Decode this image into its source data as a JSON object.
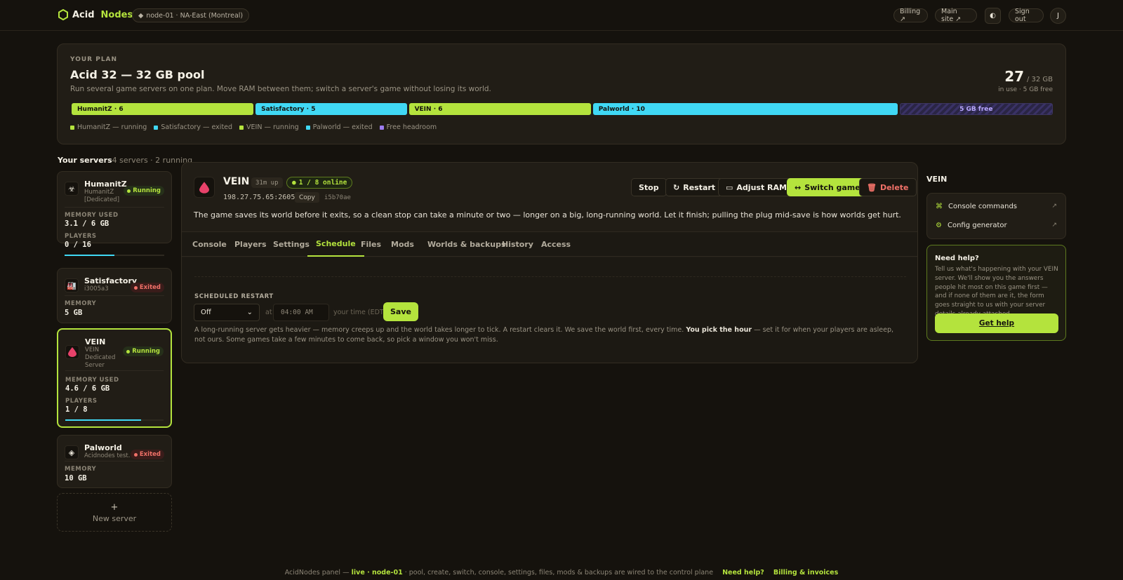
{
  "header": {
    "brand_a": "Acid",
    "brand_b": "Nodes",
    "node": "node-01 · NA-East (Montreal)",
    "billing": "Billing ↗",
    "main_site": "Main site ↗",
    "theme_icon": "◐",
    "sign_out": "Sign out",
    "avatar": "J"
  },
  "plan": {
    "eyebrow": "YOUR PLAN",
    "title": "Acid 32 — 32 GB pool",
    "subtitle": "Run several game servers on one plan. Move RAM between them; switch a server's game without losing its world.",
    "used": "27",
    "total": "/ 32 GB",
    "note": "in use · 5 GB free",
    "segments": [
      {
        "label": "HumanitZ · 6",
        "gb": 6,
        "color": "green"
      },
      {
        "label": "Satisfactory · 5",
        "gb": 5,
        "color": "blue"
      },
      {
        "label": "VEIN · 6",
        "gb": 6,
        "color": "green"
      },
      {
        "label": "Palworld · 10",
        "gb": 10,
        "color": "blue"
      },
      {
        "label": "5 GB free",
        "gb": 5,
        "color": "free"
      }
    ],
    "legend": [
      {
        "label": "HumanitZ — running",
        "color": "#b4e33d"
      },
      {
        "label": "Satisfactory — exited",
        "color": "#40d8f4"
      },
      {
        "label": "VEIN — running",
        "color": "#b4e33d"
      },
      {
        "label": "Palworld — exited",
        "color": "#40d8f4"
      },
      {
        "label": "Free headroom",
        "color": "#9d7cf0"
      }
    ]
  },
  "servers": {
    "heading": "Your servers",
    "summary": "4 servers · 2 running",
    "new_label": "New server",
    "items": [
      {
        "name": "HumanitZ",
        "sub": "HumanitZ [Dedicated]",
        "status": "Running",
        "mem_label": "MEMORY USED",
        "mem": "3.1 / 6 GB",
        "players_label": "PLAYERS",
        "players": "0 / 16",
        "progress": 0.5
      },
      {
        "name": "Satisfactory",
        "sub": "i3005a3",
        "status": "Exited",
        "mem_label": "MEMORY",
        "mem": "5 GB"
      },
      {
        "name": "VEIN",
        "sub": "VEIN Dedicated Server",
        "status": "Running",
        "mem_label": "MEMORY USED",
        "mem": "4.6 / 6 GB",
        "players_label": "PLAYERS",
        "players": "1 / 8",
        "progress": 0.77
      },
      {
        "name": "Palworld",
        "sub": "Acidnodes test.",
        "status": "Exited",
        "mem_label": "MEMORY",
        "mem": "10 GB"
      }
    ]
  },
  "main": {
    "name": "VEIN",
    "uptime": "31m up",
    "online": "1 / 8 online",
    "address": "198.27.75.65:26050",
    "copy": "Copy",
    "hash": "i5b70ae",
    "actions": {
      "stop": "Stop",
      "restart": "Restart",
      "adjust": "Adjust RAM",
      "switch": "Switch game",
      "delete": "Delete"
    },
    "message": "The game saves its world before it exits, so a clean stop can take a minute or two — longer on a big, long-running world. Let it finish; pulling the plug mid-save is how worlds get hurt.",
    "tabs": [
      "Console",
      "Players",
      "Settings",
      "Schedule",
      "Files",
      "Mods",
      "Worlds & backups",
      "History",
      "Access"
    ],
    "active_tab": "Schedule",
    "schedule": {
      "heading": "SCHEDULED RESTART",
      "select_value": "Off",
      "at": "at",
      "time_placeholder": "04:00 AM",
      "tz": "your time (EDT)",
      "save": "Save",
      "desc_a": "A long-running server gets heavier — memory creeps up and the world takes longer to tick. A restart clears it. We save the world first, every time.",
      "desc_bold": "You pick the hour",
      "desc_b": "— set it for when your players are asleep, not ours. Some games take a few minutes to come back, so pick a window you won't miss."
    }
  },
  "sidebar": {
    "title": "VEIN",
    "link1": "Console commands",
    "link2": "Config generator",
    "help_title": "Need help?",
    "help_text": "Tell us what's happening with your VEIN server. We'll show you the answers people hit most on this game first — and if none of them are it, the form goes straight to us with your server details already attached.",
    "help_button": "Get help"
  },
  "footer": {
    "prefix": "AcidNodes panel —",
    "live": "live · node-01",
    "rest": "· pool, create, switch, console, settings, files, mods & backups are wired to the control plane",
    "help": "Need help?",
    "billing": "Billing & invoices"
  }
}
